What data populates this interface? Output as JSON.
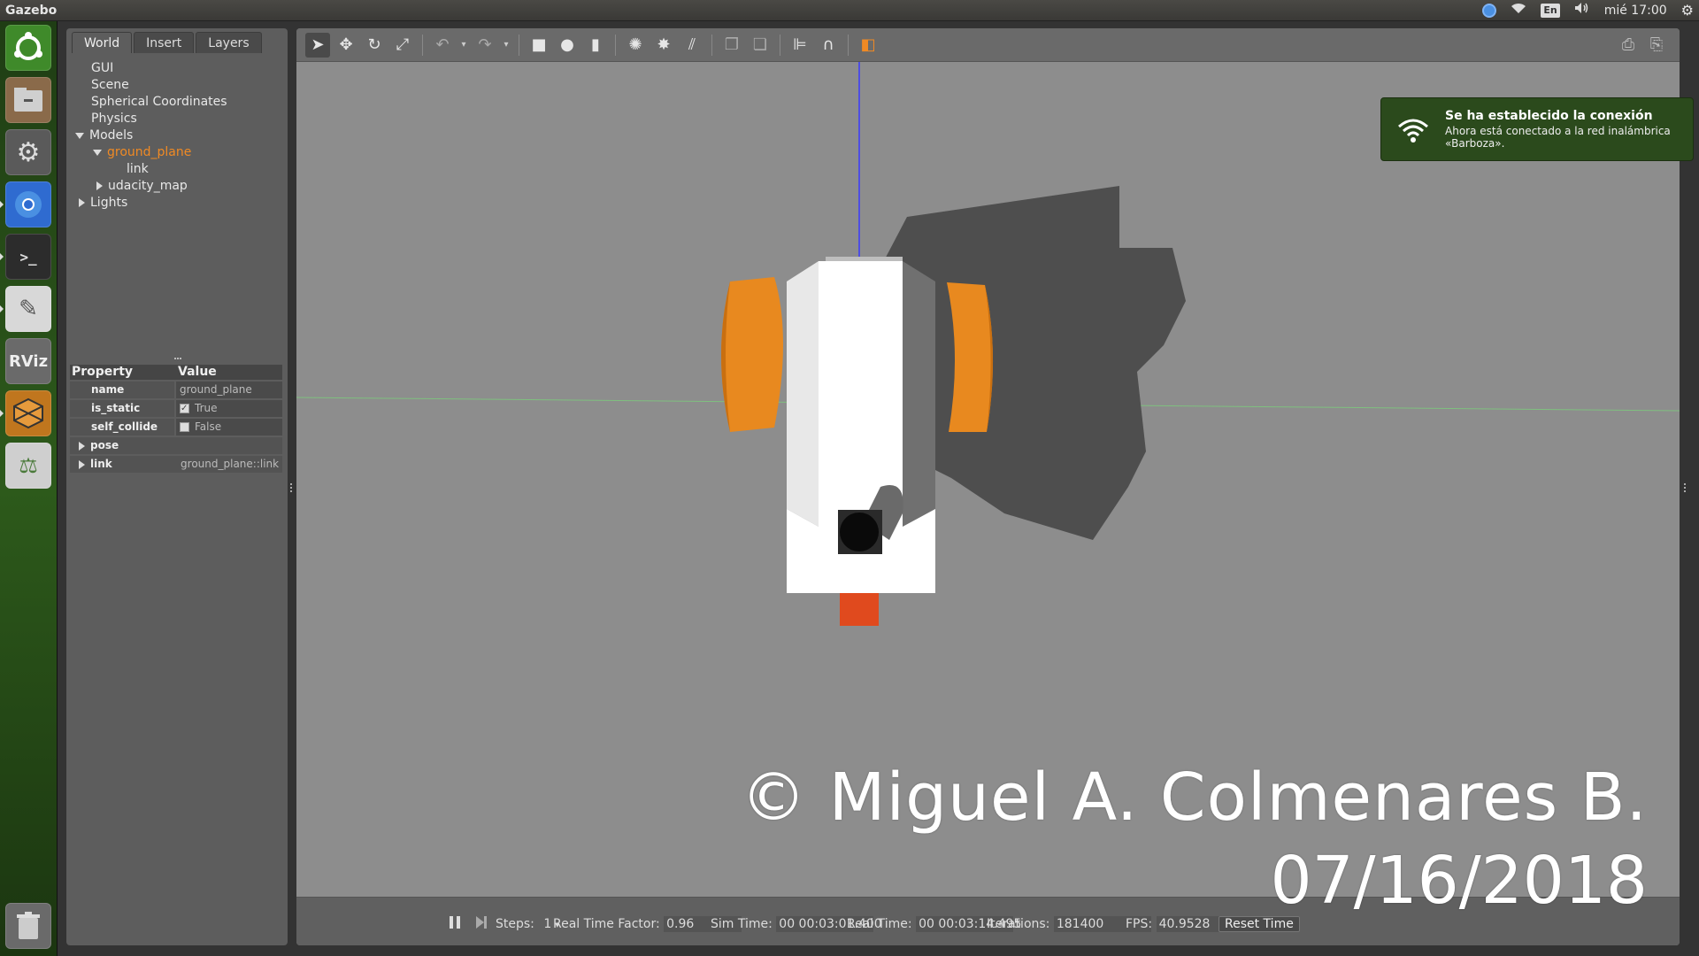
{
  "topbar": {
    "app_title": "Gazebo",
    "lang": "En",
    "clock": "mié 17:00"
  },
  "launcher": {
    "items": [
      "ubuntu-dash",
      "files",
      "system-settings",
      "chromium",
      "terminal",
      "text-editor",
      "rviz",
      "gazebo",
      "software"
    ],
    "rviz_label": "RViz"
  },
  "left_panel": {
    "tabs": [
      "World",
      "Insert",
      "Layers"
    ],
    "active_tab": "World",
    "tree": {
      "gui": "GUI",
      "scene": "Scene",
      "spherical": "Spherical Coordinates",
      "physics": "Physics",
      "models": "Models",
      "ground_plane": "ground_plane",
      "link": "link",
      "udacity_map": "udacity_map",
      "lights": "Lights"
    },
    "properties": {
      "header_property": "Property",
      "header_value": "Value",
      "name_label": "name",
      "name_value": "ground_plane",
      "is_static_label": "is_static",
      "is_static_value": "True",
      "self_collide_label": "self_collide",
      "self_collide_value": "False",
      "pose_label": "pose",
      "link_label": "link",
      "link_value": "ground_plane::link"
    }
  },
  "notification": {
    "title": "Se ha establecido la conexión",
    "body": "Ahora está conectado a la red inalámbrica «Barboza»."
  },
  "watermark": {
    "line1": "© Miguel A. Colmenares B.",
    "line2": "07/16/2018"
  },
  "bottombar": {
    "steps_label": "Steps:",
    "steps_value": "1",
    "rtf_label": "Real Time Factor:",
    "rtf_value": "0.96",
    "sim_time_label": "Sim Time:",
    "sim_time_value": "00 00:03:01.400",
    "real_time_label": "Real Time:",
    "real_time_value": "00 00:03:14.495",
    "iterations_label": "Iterations:",
    "iterations_value": "181400",
    "fps_label": "FPS:",
    "fps_value": "40.9528",
    "reset_label": "Reset Time"
  },
  "colors": {
    "wheel": "#e8891f",
    "body": "#ffffff",
    "sensor": "#e04a1e",
    "y_axis": "#3333ff",
    "x_axis": "#66cc66",
    "accent_orange": "#f08a24"
  }
}
